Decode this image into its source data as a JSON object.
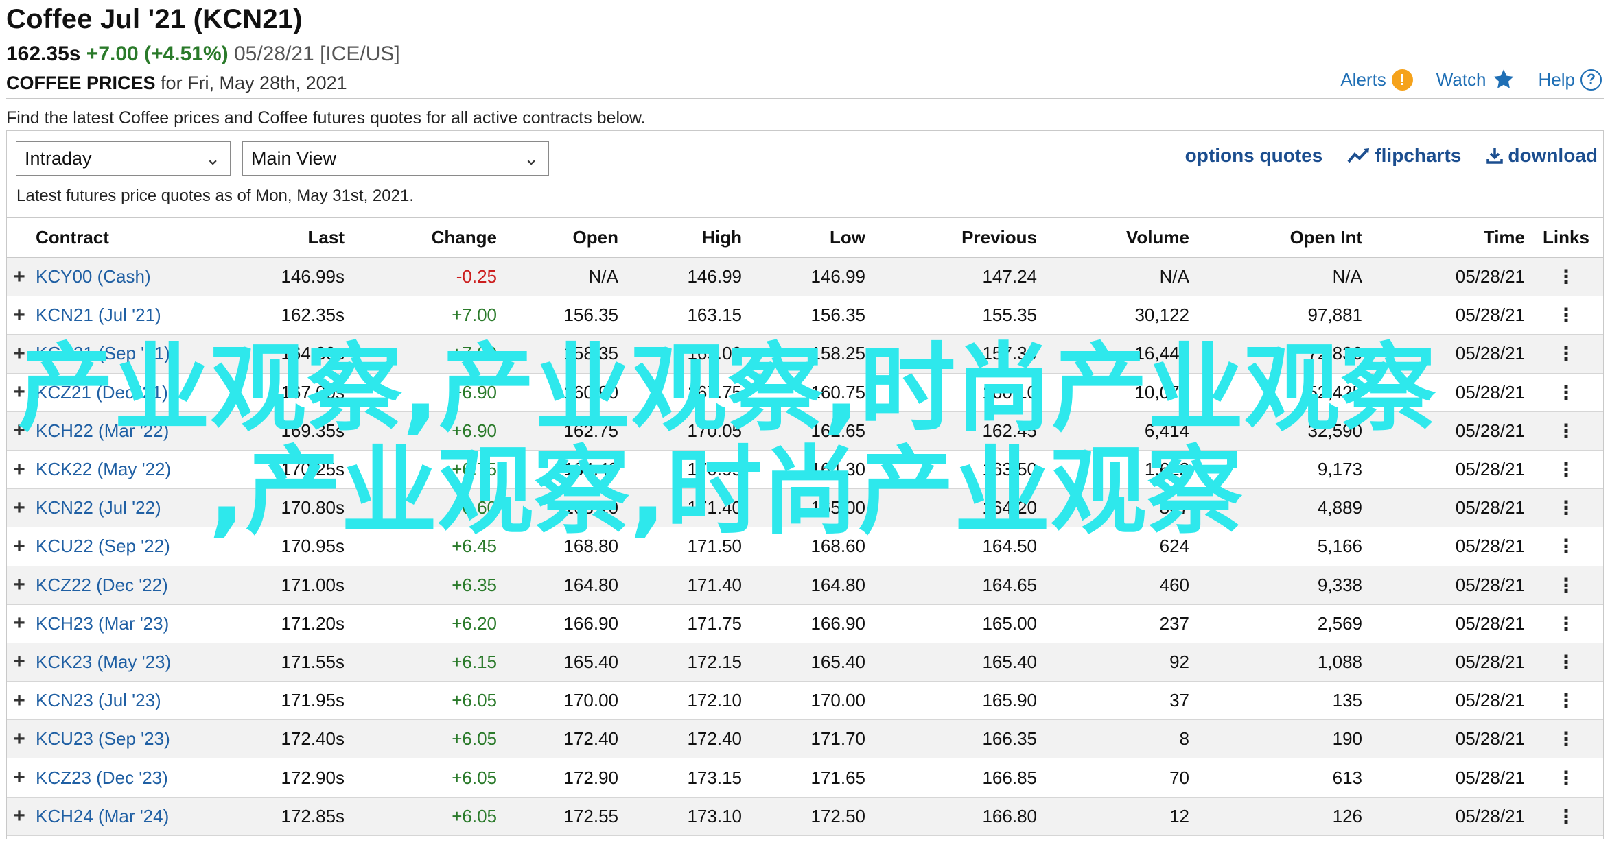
{
  "header": {
    "title": "Coffee Jul '21 (KCN21)",
    "price": "162.35s",
    "change": "+7.00 (+4.51%)",
    "date_exchange": "05/28/21 [ICE/US]",
    "sub_strong": "COFFEE PRICES",
    "sub_rest": "for Fri, May 28th, 2021"
  },
  "top_links": {
    "alerts": "Alerts",
    "alerts_icon": "!",
    "watch": "Watch",
    "help": "Help",
    "help_icon": "?"
  },
  "description": "Find the latest Coffee prices and Coffee futures quotes for all active contracts below.",
  "controls": {
    "period_select": "Intraday",
    "view_select": "Main View",
    "chevron": "⌄",
    "options_quotes": "options quotes",
    "flipcharts": "flipcharts",
    "download": "download"
  },
  "as_of": "Latest futures price quotes as of Mon, May 31st, 2021.",
  "table": {
    "columns": [
      "Contract",
      "Last",
      "Change",
      "Open",
      "High",
      "Low",
      "Previous",
      "Volume",
      "Open Int",
      "Time",
      "Links"
    ],
    "plus_glyph": "+",
    "links_glyph": "⋮",
    "rows": [
      {
        "contract": "KCY00 (Cash)",
        "last": "146.99s",
        "change": "-0.25",
        "dir": "neg",
        "open": "N/A",
        "high": "146.99",
        "low": "146.99",
        "previous": "147.24",
        "volume": "N/A",
        "open_int": "N/A",
        "time": "05/28/21"
      },
      {
        "contract": "KCN21 (Jul '21)",
        "last": "162.35s",
        "change": "+7.00",
        "dir": "pos",
        "open": "156.35",
        "high": "163.15",
        "low": "156.35",
        "previous": "155.35",
        "volume": "30,122",
        "open_int": "97,881",
        "time": "05/28/21"
      },
      {
        "contract": "KCU21 (Sep '21)",
        "last": "164.30s",
        "change": "+7.00",
        "dir": "pos",
        "open": "158.35",
        "high": "165.00",
        "low": "158.25",
        "previous": "157.30",
        "volume": "16,447",
        "open_int": "72,836",
        "time": "05/28/21"
      },
      {
        "contract": "KCZ21 (Dec '21)",
        "last": "167.00s",
        "change": "+6.90",
        "dir": "pos",
        "open": "160.90",
        "high": "167.75",
        "low": "160.75",
        "previous": "160.10",
        "volume": "10,076",
        "open_int": "52,425",
        "time": "05/28/21"
      },
      {
        "contract": "KCH22 (Mar '22)",
        "last": "169.35s",
        "change": "+6.90",
        "dir": "pos",
        "open": "162.75",
        "high": "170.05",
        "low": "162.65",
        "previous": "162.45",
        "volume": "6,414",
        "open_int": "32,590",
        "time": "05/28/21"
      },
      {
        "contract": "KCK22 (May '22)",
        "last": "170.25s",
        "change": "+6.75",
        "dir": "pos",
        "open": "164.40",
        "high": "170.95",
        "low": "164.30",
        "previous": "163.50",
        "volume": "1,622",
        "open_int": "9,173",
        "time": "05/28/21"
      },
      {
        "contract": "KCN22 (Jul '22)",
        "last": "170.80s",
        "change": "+6.60",
        "dir": "pos",
        "open": "165.10",
        "high": "171.40",
        "low": "165.00",
        "previous": "164.20",
        "volume": "807",
        "open_int": "4,889",
        "time": "05/28/21"
      },
      {
        "contract": "KCU22 (Sep '22)",
        "last": "170.95s",
        "change": "+6.45",
        "dir": "pos",
        "open": "168.80",
        "high": "171.50",
        "low": "168.60",
        "previous": "164.50",
        "volume": "624",
        "open_int": "5,166",
        "time": "05/28/21"
      },
      {
        "contract": "KCZ22 (Dec '22)",
        "last": "171.00s",
        "change": "+6.35",
        "dir": "pos",
        "open": "164.80",
        "high": "171.40",
        "low": "164.80",
        "previous": "164.65",
        "volume": "460",
        "open_int": "9,338",
        "time": "05/28/21"
      },
      {
        "contract": "KCH23 (Mar '23)",
        "last": "171.20s",
        "change": "+6.20",
        "dir": "pos",
        "open": "166.90",
        "high": "171.75",
        "low": "166.90",
        "previous": "165.00",
        "volume": "237",
        "open_int": "2,569",
        "time": "05/28/21"
      },
      {
        "contract": "KCK23 (May '23)",
        "last": "171.55s",
        "change": "+6.15",
        "dir": "pos",
        "open": "165.40",
        "high": "172.15",
        "low": "165.40",
        "previous": "165.40",
        "volume": "92",
        "open_int": "1,088",
        "time": "05/28/21"
      },
      {
        "contract": "KCN23 (Jul '23)",
        "last": "171.95s",
        "change": "+6.05",
        "dir": "pos",
        "open": "170.00",
        "high": "172.10",
        "low": "170.00",
        "previous": "165.90",
        "volume": "37",
        "open_int": "135",
        "time": "05/28/21"
      },
      {
        "contract": "KCU23 (Sep '23)",
        "last": "172.40s",
        "change": "+6.05",
        "dir": "pos",
        "open": "172.40",
        "high": "172.40",
        "low": "171.70",
        "previous": "166.35",
        "volume": "8",
        "open_int": "190",
        "time": "05/28/21"
      },
      {
        "contract": "KCZ23 (Dec '23)",
        "last": "172.90s",
        "change": "+6.05",
        "dir": "pos",
        "open": "172.90",
        "high": "173.15",
        "low": "171.65",
        "previous": "166.85",
        "volume": "70",
        "open_int": "613",
        "time": "05/28/21"
      },
      {
        "contract": "KCH24 (Mar '24)",
        "last": "172.85s",
        "change": "+6.05",
        "dir": "pos",
        "open": "172.55",
        "high": "173.10",
        "low": "172.50",
        "previous": "166.80",
        "volume": "12",
        "open_int": "126",
        "time": "05/28/21"
      }
    ]
  },
  "watermark": {
    "line1": "产业观察,产业观察,时尚产业观察",
    "line2": ",产业观察,时尚产业观察",
    "color": "#2ee8ec"
  },
  "colors": {
    "link_blue": "#1f6fb5",
    "positive": "#2a7a2a",
    "negative": "#cc1f1f",
    "alert_orange": "#f5a21b"
  }
}
